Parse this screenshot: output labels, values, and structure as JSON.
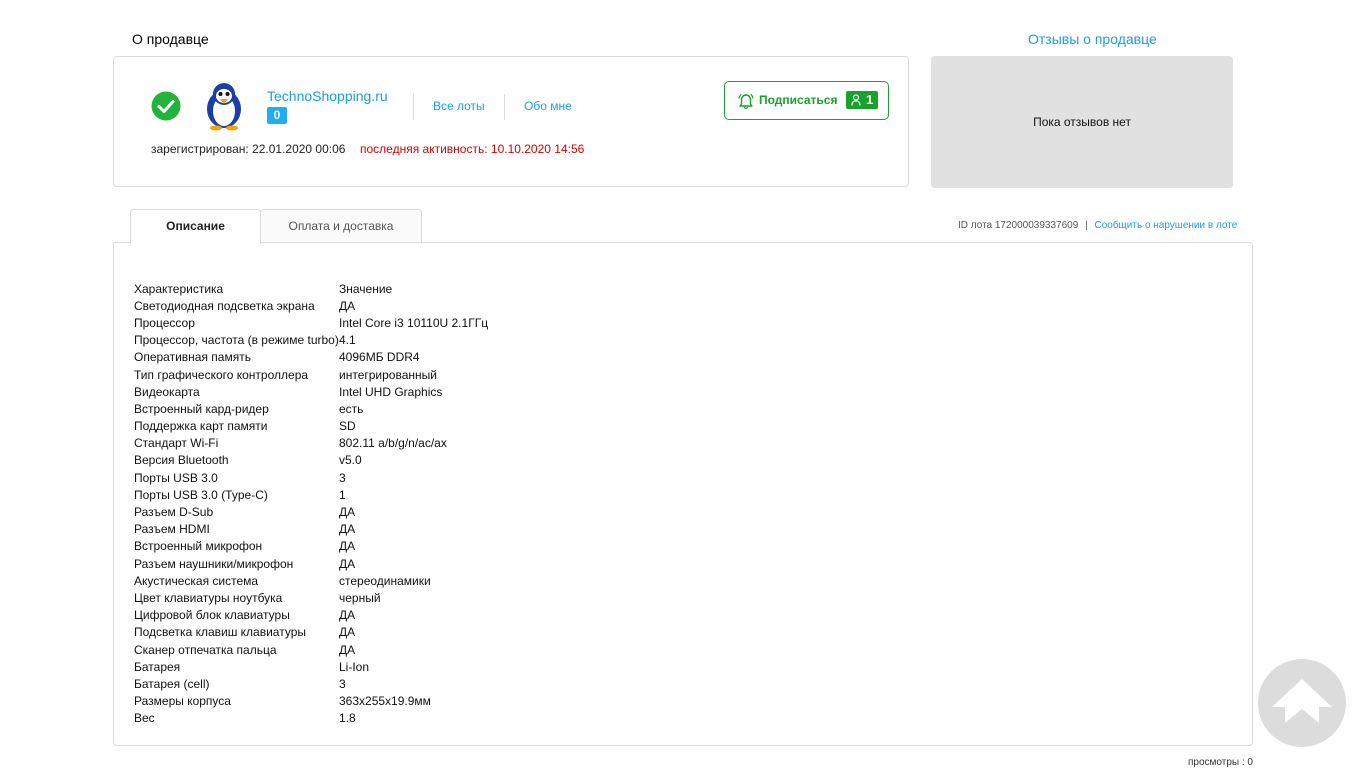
{
  "seller_section": {
    "heading": "О продавце",
    "reviews_heading": "Отзывы о продавце",
    "seller_name": "TechnoShopping.ru",
    "rating": "0",
    "links": {
      "all_lots": "Все лоты",
      "about_me": "Обо мне"
    },
    "registered": "зарегистрирован: 22.01.2020 00:06",
    "last_activity": "последняя активность: 10.10.2020 14:56",
    "subscribe": {
      "label": "Подписаться",
      "count": "1"
    },
    "reviews_empty": "Пока отзывов нет"
  },
  "tabs": [
    {
      "label": "Описание",
      "active": true
    },
    {
      "label": "Оплата и доставка",
      "active": false
    }
  ],
  "lot_info": {
    "id_text": "ID лота 172000039337609",
    "divider": "|",
    "report_link": "Сообщить о нарушении в лоте"
  },
  "specs": [
    {
      "key": "Характеристика",
      "value": "Значение"
    },
    {
      "key": "Светодиодная подсветка экрана",
      "value": "ДА"
    },
    {
      "key": "Процессор",
      "value": "Intel Core i3 10110U 2.1ГГц"
    },
    {
      "key": "Процессор, частота (в режиме turbo)",
      "value": "4.1"
    },
    {
      "key": "Оперативная память",
      "value": "4096МБ DDR4"
    },
    {
      "key": "Тип графического контроллера",
      "value": "интегрированный"
    },
    {
      "key": "Видеокарта",
      "value": "Intel UHD Graphics"
    },
    {
      "key": "Встроенный кард-ридер",
      "value": "есть"
    },
    {
      "key": "Поддержка карт памяти",
      "value": "SD"
    },
    {
      "key": "Стандарт Wi-Fi",
      "value": "802.11 a/b/g/n/ac/ax"
    },
    {
      "key": "Версия Bluetooth",
      "value": "v5.0"
    },
    {
      "key": "Порты USB 3.0",
      "value": "3"
    },
    {
      "key": "Порты USB 3.0 (Type-C)",
      "value": "1"
    },
    {
      "key": "Разъем D-Sub",
      "value": "ДА"
    },
    {
      "key": "Разъем HDMI",
      "value": "ДА"
    },
    {
      "key": "Встроенный микрофон",
      "value": "ДА"
    },
    {
      "key": "Разъем наушники/микрофон",
      "value": "ДА"
    },
    {
      "key": "Акустическая система",
      "value": "стереодинамики"
    },
    {
      "key": "Цвет клавиатуры ноутбука",
      "value": "черный"
    },
    {
      "key": "Цифровой блок клавиатуры",
      "value": "ДА"
    },
    {
      "key": "Подсветка клавиш клавиатуры",
      "value": "ДА"
    },
    {
      "key": "Сканер отпечатка пальца",
      "value": "ДА"
    },
    {
      "key": "Батарея",
      "value": "Li-Ion"
    },
    {
      "key": "Батарея (cell)",
      "value": "3"
    },
    {
      "key": "Размеры корпуса",
      "value": "363x255x19.9мм"
    },
    {
      "key": "Вес",
      "value": "1.8"
    }
  ],
  "views": "просмотры : 0",
  "icons": {
    "verified": "check-circle-icon",
    "avatar": "penguin-icon",
    "subscribe": "bell-icon",
    "subscribers": "person-icon",
    "scroll_top": "arrow-up-icon"
  },
  "colors": {
    "link": "#1a9ee6",
    "verified_green": "#22b43a",
    "subscribe_green": "#18a22a",
    "activity_red": "#d80000",
    "badge_blue": "#1eaff0",
    "reviews_bg": "#e1e1e1"
  }
}
